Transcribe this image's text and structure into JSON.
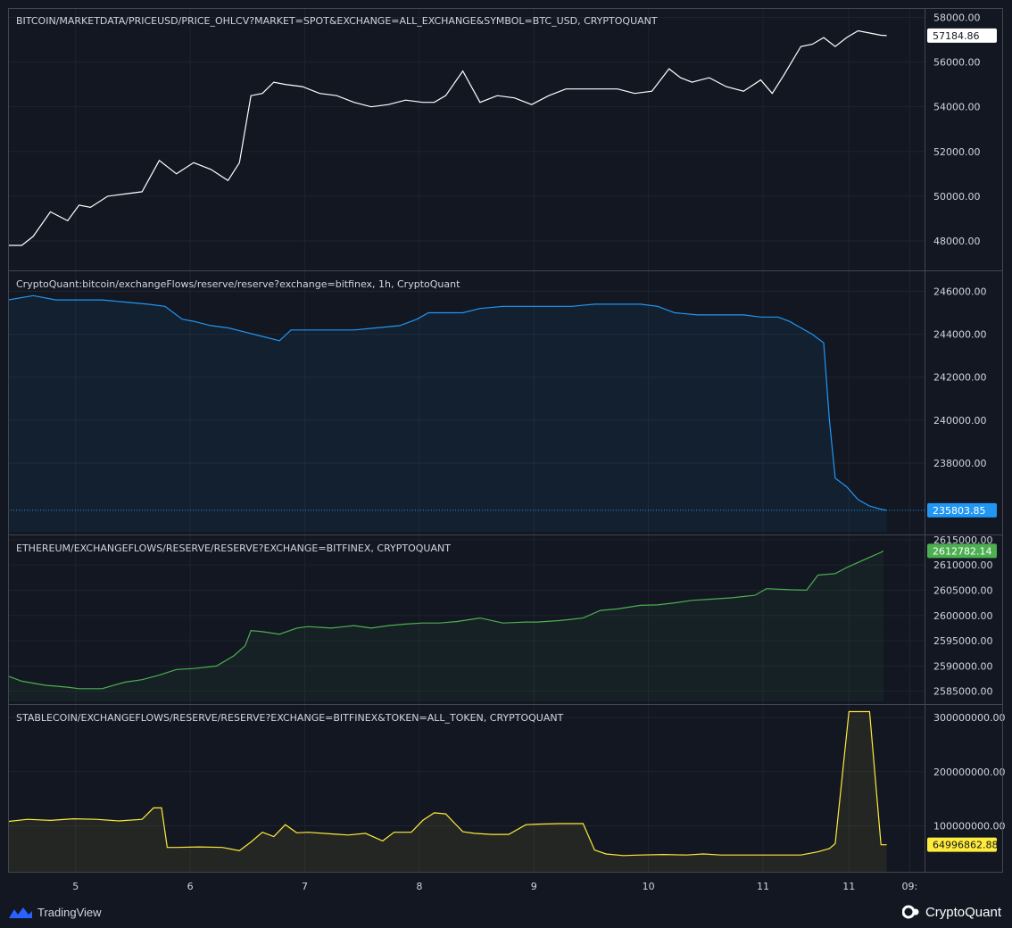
{
  "colors": {
    "background": "#131722",
    "grid": "#1f232e",
    "separator": "#434651",
    "text": "#d1d4dc",
    "price_line": "#ffffff",
    "btc_reserve": "#2196f3",
    "eth_reserve": "#4caf50",
    "stable_reserve": "#ffeb3b"
  },
  "time_axis": {
    "ticks": [
      "5",
      "6",
      "7",
      "8",
      "9",
      "10",
      "11",
      "11",
      "09:"
    ]
  },
  "branding": {
    "tradingview": "TradingView",
    "cryptoquant": "CryptoQuant"
  },
  "chart_data": [
    {
      "type": "line",
      "title": "BITCOIN/MARKETDATA/PRICEUSD/PRICE_OHLCV?MARKET=SPOT&EXCHANGE=ALL_EXCHANGE&SYMBOL=BTC_USD, CRYPTOQUANT",
      "color": "#ffffff",
      "ylim": [
        46800,
        58300
      ],
      "yticks": [
        "58000.00",
        "56000.00",
        "54000.00",
        "52000.00",
        "50000.00",
        "48000.00"
      ],
      "ytick_values": [
        58000,
        56000,
        54000,
        52000,
        50000,
        48000
      ],
      "last_value_label": "57184.86",
      "last_value": 57184.86,
      "last_label_bg": "#ffffff",
      "last_label_fg": "#131722",
      "x": [
        4.38,
        4.5,
        4.6,
        4.75,
        4.9,
        5.0,
        5.1,
        5.25,
        5.4,
        5.55,
        5.7,
        5.85,
        6.0,
        6.15,
        6.3,
        6.4,
        6.5,
        6.6,
        6.7,
        6.8,
        6.95,
        7.1,
        7.25,
        7.4,
        7.55,
        7.7,
        7.85,
        8.0,
        8.1,
        8.2,
        8.35,
        8.5,
        8.65,
        8.8,
        8.95,
        9.1,
        9.25,
        9.4,
        9.55,
        9.7,
        9.85,
        10.0,
        10.15,
        10.25,
        10.35,
        10.5,
        10.65,
        10.8,
        10.95,
        11.05,
        11.15,
        11.3,
        11.4,
        11.5,
        11.6,
        11.7,
        11.8,
        11.9,
        12.0,
        12.05
      ],
      "y": [
        47800,
        47800,
        48200,
        49300,
        48900,
        49600,
        49500,
        50000,
        50100,
        50200,
        51600,
        51000,
        51500,
        51200,
        50700,
        51500,
        54500,
        54600,
        55100,
        55000,
        54900,
        54600,
        54500,
        54200,
        54000,
        54100,
        54300,
        54200,
        54200,
        54500,
        55600,
        54200,
        54500,
        54400,
        54100,
        54500,
        54800,
        54800,
        54800,
        54800,
        54600,
        54700,
        55700,
        55300,
        55100,
        55300,
        54900,
        54700,
        55200,
        54600,
        55400,
        56700,
        56800,
        57100,
        56700,
        57100,
        57400,
        57300,
        57200,
        57184.86
      ]
    },
    {
      "type": "area",
      "title": "CryptoQuant:bitcoin/exchangeFlows/reserve/reserve?exchange=bitfinex, 1h, CryptoQuant",
      "color": "#2196f3",
      "ylim": [
        234800,
        246600
      ],
      "yticks": [
        "246000.00",
        "244000.00",
        "242000.00",
        "240000.00",
        "238000.00"
      ],
      "ytick_values": [
        246000,
        244000,
        242000,
        240000,
        238000
      ],
      "last_value_label": "235803.85",
      "last_value": 235803.85,
      "last_label_bg": "#2196f3",
      "last_label_fg": "#ffffff",
      "x": [
        4.38,
        4.6,
        4.8,
        5.0,
        5.2,
        5.4,
        5.6,
        5.75,
        5.9,
        6.0,
        6.15,
        6.3,
        6.45,
        6.6,
        6.75,
        6.85,
        7.0,
        7.2,
        7.4,
        7.6,
        7.8,
        7.95,
        8.05,
        8.2,
        8.35,
        8.5,
        8.7,
        8.9,
        9.1,
        9.3,
        9.5,
        9.7,
        9.9,
        10.05,
        10.2,
        10.4,
        10.6,
        10.8,
        10.95,
        11.1,
        11.2,
        11.3,
        11.4,
        11.5,
        11.55,
        11.6,
        11.7,
        11.8,
        11.9,
        12.0,
        12.05
      ],
      "y": [
        245600,
        245800,
        245600,
        245600,
        245600,
        245500,
        245400,
        245300,
        244700,
        244600,
        244400,
        244300,
        244100,
        243900,
        243700,
        244200,
        244200,
        244200,
        244200,
        244300,
        244400,
        244700,
        245000,
        245000,
        245000,
        245200,
        245300,
        245300,
        245300,
        245300,
        245400,
        245400,
        245400,
        245300,
        245000,
        244900,
        244900,
        244900,
        244800,
        244800,
        244600,
        244300,
        244000,
        243600,
        240000,
        237300,
        236900,
        236300,
        236000,
        235850,
        235803.85
      ]
    },
    {
      "type": "area",
      "title": "ETHEREUM/EXCHANGEFLOWS/RESERVE/RESERVE?EXCHANGE=BITFINEX, CRYPTOQUANT",
      "color": "#4caf50",
      "ylim": [
        2583000,
        2615500
      ],
      "yticks": [
        "2615000.00",
        "2610000.00",
        "2605000.00",
        "2600000.00",
        "2595000.00",
        "2590000.00",
        "2585000.00"
      ],
      "ytick_values": [
        2615000,
        2610000,
        2605000,
        2600000,
        2595000,
        2590000,
        2585000
      ],
      "last_value_label": "2612782.14",
      "last_value": 2612782.14,
      "last_label_bg": "#4caf50",
      "last_label_fg": "#ffffff",
      "x": [
        4.38,
        4.5,
        4.7,
        4.9,
        5.0,
        5.2,
        5.4,
        5.55,
        5.7,
        5.85,
        6.0,
        6.2,
        6.35,
        6.45,
        6.5,
        6.6,
        6.75,
        6.9,
        7.0,
        7.2,
        7.4,
        7.55,
        7.7,
        7.85,
        8.0,
        8.15,
        8.3,
        8.5,
        8.7,
        8.9,
        9.0,
        9.2,
        9.4,
        9.55,
        9.7,
        9.9,
        10.05,
        10.2,
        10.35,
        10.5,
        10.7,
        10.9,
        11.0,
        11.2,
        11.35,
        11.45,
        11.6,
        11.7,
        11.8,
        11.9,
        12.0,
        12.02
      ],
      "y": [
        2588000,
        2587000,
        2586200,
        2585800,
        2585500,
        2585500,
        2586800,
        2587300,
        2588200,
        2589300,
        2589500,
        2590000,
        2592000,
        2594000,
        2597000,
        2596800,
        2596300,
        2597500,
        2597800,
        2597500,
        2598000,
        2597500,
        2598000,
        2598300,
        2598500,
        2598500,
        2598800,
        2599500,
        2598500,
        2598700,
        2598700,
        2599000,
        2599500,
        2601000,
        2601300,
        2602000,
        2602100,
        2602500,
        2603000,
        2603200,
        2603500,
        2604000,
        2605300,
        2605100,
        2605000,
        2608000,
        2608300,
        2609500,
        2610500,
        2611500,
        2612500,
        2612782.14
      ]
    },
    {
      "type": "area",
      "title": "STABLECOIN/EXCHANGEFLOWS/RESERVE/RESERVE?EXCHANGE=BITFINEX&TOKEN=ALL_TOKEN, CRYPTOQUANT",
      "color": "#ffeb3b",
      "ylim": [
        15000000,
        320000000
      ],
      "yticks": [
        "300000000.00",
        "200000000.00",
        "100000000.00"
      ],
      "ytick_values": [
        300000000,
        200000000,
        100000000
      ],
      "last_value_label": "64996862.88",
      "last_value": 64996862.88,
      "last_label_bg": "#ffeb3b",
      "last_label_fg": "#131722",
      "x": [
        4.38,
        4.55,
        4.75,
        4.95,
        5.15,
        5.35,
        5.55,
        5.65,
        5.72,
        5.77,
        5.85,
        6.05,
        6.25,
        6.4,
        6.5,
        6.6,
        6.7,
        6.8,
        6.9,
        7.0,
        7.2,
        7.35,
        7.5,
        7.65,
        7.75,
        7.9,
        8.0,
        8.1,
        8.2,
        8.35,
        8.45,
        8.6,
        8.75,
        8.9,
        9.0,
        9.2,
        9.4,
        9.5,
        9.6,
        9.75,
        9.9,
        10.1,
        10.3,
        10.45,
        10.6,
        10.8,
        11.0,
        11.15,
        11.3,
        11.45,
        11.55,
        11.6,
        11.72,
        11.85,
        11.9,
        12.0,
        12.05
      ],
      "y": [
        108000000,
        112000000,
        110000000,
        113000000,
        112000000,
        109000000,
        112000000,
        133000000,
        133000000,
        60000000,
        60000000,
        61000000,
        60000000,
        54000000,
        70000000,
        88000000,
        80000000,
        102000000,
        87000000,
        88000000,
        85000000,
        83000000,
        86000000,
        72000000,
        88000000,
        88000000,
        110000000,
        124000000,
        122000000,
        89000000,
        86000000,
        84000000,
        84000000,
        102000000,
        103000000,
        104000000,
        104000000,
        55000000,
        48000000,
        45000000,
        46000000,
        47000000,
        46000000,
        48000000,
        46000000,
        46000000,
        46000000,
        46000000,
        46000000,
        52000000,
        58000000,
        67000000,
        311000000,
        311000000,
        311000000,
        65000000,
        64996862.88
      ]
    }
  ]
}
